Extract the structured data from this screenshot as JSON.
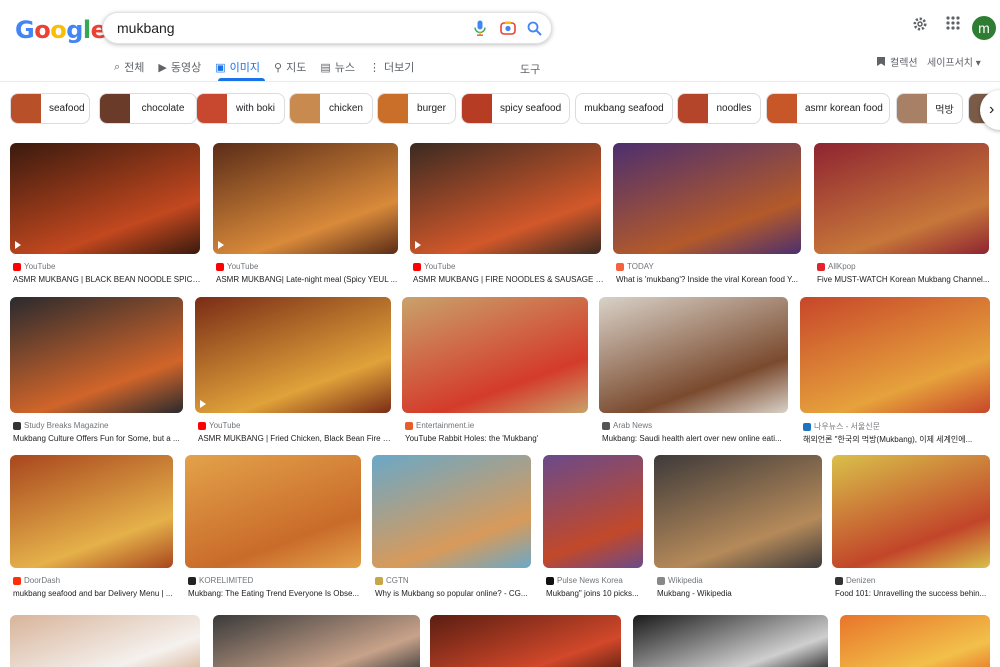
{
  "logo": {
    "letters": [
      "G",
      "o",
      "o",
      "g",
      "l",
      "e"
    ],
    "colors": [
      "#4285f4",
      "#ea4335",
      "#fbbc05",
      "#4285f4",
      "#34a853",
      "#ea4335"
    ]
  },
  "search": {
    "value": "mukbang",
    "mic_icon": "microphone-icon",
    "lens_icon": "camera-lens-icon",
    "search_icon": "search-icon"
  },
  "header": {
    "settings_icon": "gear-icon",
    "apps_icon": "apps-grid-icon",
    "avatar_letter": "m",
    "avatar_color": "#2f7d32"
  },
  "tabs": [
    {
      "icon": "⌕",
      "label": "전체"
    },
    {
      "icon": "▶",
      "label": "동영상"
    },
    {
      "icon": "▣",
      "label": "이미지",
      "active": true
    },
    {
      "icon": "⚲",
      "label": "지도"
    },
    {
      "icon": "▤",
      "label": "뉴스"
    },
    {
      "icon": "⋮",
      "label": "더보기"
    }
  ],
  "tools_label": "도구",
  "collections_label": "컬렉션",
  "safesearch_label": "세이프서치",
  "chips": [
    {
      "label": "seafood",
      "color": "#b8502a"
    },
    {
      "label": "chocolate",
      "color": "#6b3b2a"
    },
    {
      "label": "with boki",
      "color": "#c7482f"
    },
    {
      "label": "chicken",
      "color": "#c98a50"
    },
    {
      "label": "burger",
      "color": "#c96f2a"
    },
    {
      "label": "spicy seafood",
      "color": "#b63d23"
    },
    {
      "label": "mukbang seafood",
      "color": ""
    },
    {
      "label": "noodles",
      "color": "#b5452a"
    },
    {
      "label": "asmr korean food",
      "color": "#c75628"
    },
    {
      "label": "먹방",
      "color": "#a88066"
    },
    {
      "label": "",
      "color": "#7a5b48"
    }
  ],
  "rows": [
    [
      {
        "source": "YouTube",
        "fav": "#ff0000",
        "title": "ASMR MUKBANG | BLACK BEAN NOODLE SPICY ...",
        "c1": "#3a1a0e",
        "c2": "#c2481f",
        "video": true
      },
      {
        "source": "YouTube",
        "fav": "#ff0000",
        "title": "ASMR MUKBANG| Late-night meal (Spicy YEUL ...",
        "c1": "#5a2c18",
        "c2": "#d98a3a",
        "video": true
      },
      {
        "source": "YouTube",
        "fav": "#ff0000",
        "title": "ASMR MUKBANG | FIRE NOODLES & SAUSAGE SP...",
        "c1": "#3b2a22",
        "c2": "#d2582a",
        "video": true
      },
      {
        "source": "TODAY",
        "fav": "#f5623b",
        "title": "What is 'mukbang'? Inside the viral Korean food Y...",
        "c1": "#4c2f6e",
        "c2": "#b45a2a",
        "video": false
      },
      {
        "source": "AllKpop",
        "fav": "#e3252b",
        "title": "Five MUST-WATCH Korean Mukbang Channel...",
        "c1": "#8e2431",
        "c2": "#c7773a",
        "video": false
      }
    ],
    [
      {
        "source": "Study Breaks Magazine",
        "fav": "#333333",
        "title": "Mukbang Culture Offers Fun for Some, but a ...",
        "c1": "#2a2a2e",
        "c2": "#d1652a",
        "video": false
      },
      {
        "source": "YouTube",
        "fav": "#ff0000",
        "title": "ASMR MUKBANG | Fried Chicken, Black Bean Fire N...",
        "c1": "#7a2c16",
        "c2": "#e0a23a",
        "video": true
      },
      {
        "source": "Entertainment.ie",
        "fav": "#e85d2a",
        "title": "YouTube Rabbit Holes: the 'Mukbang'",
        "c1": "#c9a26b",
        "c2": "#d43b2a",
        "video": false
      },
      {
        "source": "Arab News",
        "fav": "#555555",
        "title": "Mukbang: Saudi health alert over new online eati...",
        "c1": "#d9d2c8",
        "c2": "#7a4a2e",
        "video": false
      },
      {
        "source": "나우뉴스 - 서울신문",
        "fav": "#1e73be",
        "title": "해외언론 \"한국의 먹방(Mukbang), 이제 세계인에...",
        "c1": "#c7462a",
        "c2": "#e6a23c",
        "video": false
      }
    ],
    [
      {
        "source": "DoorDash",
        "fav": "#ff3008",
        "title": "mukbang seafood and bar Delivery Menu | ...",
        "c1": "#a8461e",
        "c2": "#e5b14a",
        "video": false
      },
      {
        "source": "KORELIMITED",
        "fav": "#222222",
        "title": "Mukbang: The Eating Trend Everyone Is Obse...",
        "c1": "#e3a24a",
        "c2": "#c96b2a",
        "video": false
      },
      {
        "source": "CGTN",
        "fav": "#c9a54a",
        "title": "Why is Mukbang so popular online? - CG...",
        "c1": "#6aa8c8",
        "c2": "#d89a5a",
        "video": false
      },
      {
        "source": "Pulse News Korea",
        "fav": "#111111",
        "title": "Mukbang\" joins 10 picks...",
        "c1": "#6a4a8a",
        "c2": "#c2492a",
        "video": false
      },
      {
        "source": "Wikipedia",
        "fav": "#888888",
        "title": "Mukbang - Wikipedia",
        "c1": "#3e3a3a",
        "c2": "#b58a5a",
        "video": false
      },
      {
        "source": "Denizen",
        "fav": "#333333",
        "title": "Food 101: Unravelling the success behin...",
        "c1": "#d9c04a",
        "c2": "#c2452a",
        "video": false
      }
    ],
    [
      {
        "source": "",
        "fav": "",
        "title": "",
        "c1": "#d8b49a",
        "c2": "#f5f1ee",
        "video": false
      },
      {
        "source": "",
        "fav": "",
        "title": "",
        "c1": "#3a3a3a",
        "c2": "#c8a28a",
        "video": false
      },
      {
        "source": "",
        "fav": "",
        "title": "",
        "c1": "#5a1e12",
        "c2": "#d2482a",
        "video": false
      },
      {
        "source": "",
        "fav": "",
        "title": "",
        "c1": "#1a1a1a",
        "c2": "#cfcfcf",
        "video": false
      },
      {
        "source": "",
        "fav": "",
        "title": "",
        "c1": "#e8742a",
        "c2": "#f2c04a",
        "video": false
      }
    ]
  ]
}
